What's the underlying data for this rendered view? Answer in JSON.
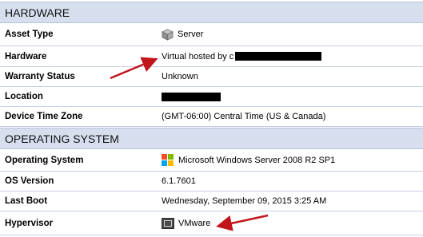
{
  "hardware": {
    "header": "HARDWARE",
    "rows": [
      {
        "label": "Asset Type",
        "value": "Server",
        "icon": "server-box-icon"
      },
      {
        "label": "Hardware",
        "value": "Virtual hosted by c"
      },
      {
        "label": "Warranty Status",
        "value": "Unknown"
      },
      {
        "label": "Location",
        "value": ""
      },
      {
        "label": "Device Time Zone",
        "value": "(GMT-06:00) Central Time (US & Canada)"
      }
    ]
  },
  "os": {
    "header": "OPERATING SYSTEM",
    "rows": [
      {
        "label": "Operating System",
        "value": "Microsoft Windows Server 2008 R2 SP1",
        "icon": "windows-logo-icon"
      },
      {
        "label": "OS Version",
        "value": "6.1.7601"
      },
      {
        "label": "Last Boot",
        "value": "Wednesday, September 09, 2015 3:25 AM"
      },
      {
        "label": "Hypervisor",
        "value": "VMware",
        "icon": "vmware-icon"
      }
    ]
  },
  "colors": {
    "header_bg": "#d7dfef",
    "row_border": "#c5cfe3",
    "annotation_arrow": "#c0151b",
    "windows_logo": [
      "#f25022",
      "#7fba00",
      "#00a4ef",
      "#ffb900"
    ]
  }
}
